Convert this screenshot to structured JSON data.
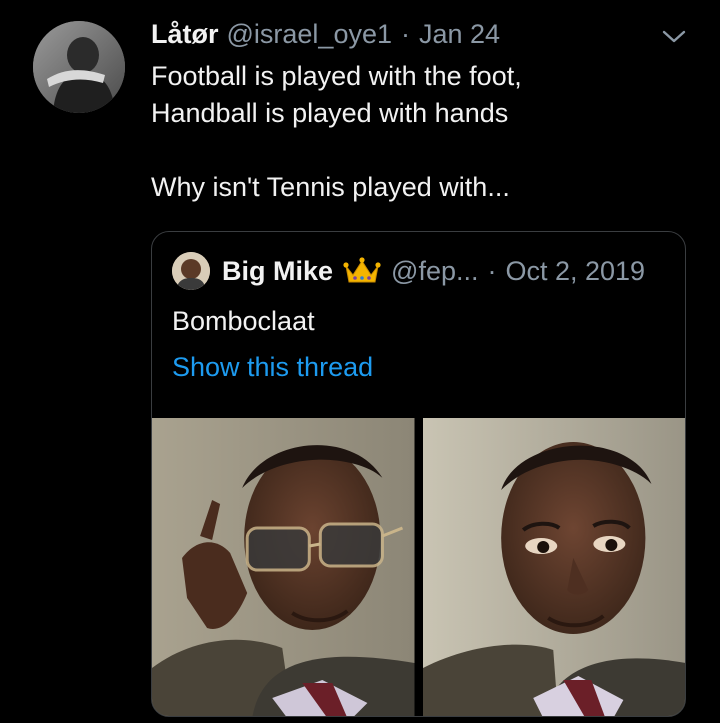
{
  "tweet": {
    "author": {
      "display_name": "Låtør",
      "handle": "@israel_oye1"
    },
    "separator": "·",
    "date": "Jan 24",
    "text_lines": [
      "Football is played with the foot,",
      "Handball is played with hands",
      "",
      "Why isn't Tennis played with..."
    ],
    "menu_icon": "chevron-down-icon"
  },
  "quote": {
    "author": {
      "display_name": "Big Mike",
      "badge_icon": "crown-emoji-icon",
      "handle": "@fep..."
    },
    "separator": "·",
    "date": "Oct 2, 2019",
    "text": "Bomboclaat",
    "thread_link": "Show this thread",
    "media_count": 2
  },
  "colors": {
    "background": "#000000",
    "text": "#f2f2f2",
    "muted": "#8b98a5",
    "link": "#1d9bf0",
    "border": "#3a3d40"
  }
}
